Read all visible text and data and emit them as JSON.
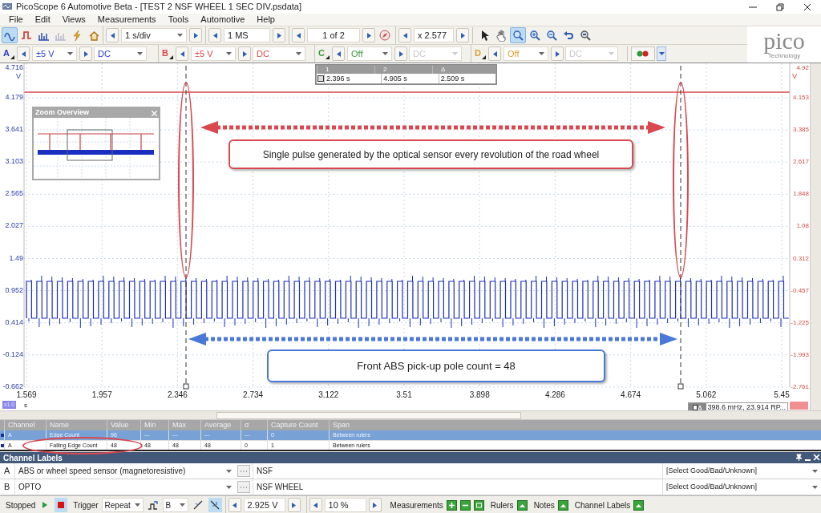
{
  "window": {
    "title": "PicoScope 6 Automotive Beta - [TEST 2  NSF WHEEL 1 SEC DIV.psdata]"
  },
  "menu": [
    "File",
    "Edit",
    "Views",
    "Measurements",
    "Tools",
    "Automotive",
    "Help"
  ],
  "toolbar": {
    "modes": [
      {
        "kind": "scope",
        "selected": true
      },
      {
        "kind": "persistence",
        "selected": false
      },
      {
        "kind": "spectrum",
        "selected": false
      },
      {
        "kind": "spectrum-disabled",
        "selected": false
      },
      {
        "kind": "lightning",
        "selected": false
      },
      {
        "kind": "home",
        "selected": false
      }
    ],
    "timebase": "1 s/div",
    "samples": "1 MS",
    "buffer": "1 of 2",
    "zoom": "x 2.577",
    "tools": [
      {
        "kind": "pointer",
        "selected": false
      },
      {
        "kind": "hand",
        "selected": false
      },
      {
        "kind": "zoom-select",
        "selected": true
      },
      {
        "kind": "zoom-in",
        "selected": false
      },
      {
        "kind": "zoom-out",
        "selected": false
      },
      {
        "kind": "undo",
        "selected": false
      },
      {
        "kind": "zoom-fit",
        "selected": false
      }
    ]
  },
  "channels": [
    {
      "letter": "A",
      "color": "#2b3fc4",
      "range": "±5 V",
      "coupling": "DC",
      "enabled": true
    },
    {
      "letter": "B",
      "color": "#e04848",
      "range": "±5 V",
      "coupling": "DC",
      "enabled": true
    },
    {
      "letter": "C",
      "color": "#3a9a3a",
      "range": "Off",
      "coupling": "DC",
      "enabled": false
    },
    {
      "letter": "D",
      "color": "#d9a030",
      "range": "Off",
      "coupling": "DC",
      "enabled": false
    }
  ],
  "logo": {
    "name": "pico",
    "tagline": "Technology"
  },
  "scope": {
    "left_axis": {
      "unit": "V",
      "ticks": [
        "4.716",
        "4.179",
        "3.641",
        "3.103",
        "2.565",
        "2.027",
        "1.49",
        "0.952",
        "0.414",
        "-0.124",
        "-0.662"
      ]
    },
    "right_axis": {
      "unit": "V",
      "ticks": [
        "4.92",
        "4.153",
        "3.385",
        "2.617",
        "1.848",
        "1.08",
        "0.312",
        "-0.457",
        "-1.225",
        "-1.993",
        "-2.761"
      ]
    },
    "x_axis": {
      "unit": "s",
      "zoom_badge": "x1.0",
      "ticks": [
        "1.569",
        "1.957",
        "2.346",
        "2.734",
        "3.122",
        "3.51",
        "3.898",
        "4.286",
        "4.674",
        "5.062",
        "5.45"
      ]
    },
    "rulers_panel": {
      "columns": [
        "1",
        "2",
        "Δ"
      ],
      "values": [
        "2.396 s",
        "4.905 s",
        "2.509 s"
      ]
    },
    "zoom_overview": {
      "title": "Zoom Overview"
    },
    "annotations": [
      {
        "text": "Single pulse generated by the optical sensor every revolution of the road wheel",
        "color": "#d9474f"
      },
      {
        "text": "Front ABS pick-up pole count = 48",
        "color": "#4a78d8"
      }
    ],
    "readout": "398.6 mHz, 23.914 RP..."
  },
  "measurements": {
    "columns": [
      "Channel",
      "Name",
      "Value",
      "Min",
      "Max",
      "Average",
      "σ",
      "Capture Count",
      "Span"
    ],
    "rows": [
      {
        "selected": true,
        "cells": [
          "A",
          "Edge Count",
          "96",
          "---",
          "---",
          "---",
          "---",
          "0",
          "Between rulers"
        ]
      },
      {
        "selected": false,
        "cells": [
          "A",
          "Falling Edge Count",
          "48",
          "48",
          "48",
          "48",
          "0",
          "1",
          "Between rulers"
        ]
      }
    ]
  },
  "channel_labels": {
    "title": "Channel Labels",
    "rows": [
      {
        "channel": "A",
        "sensor": "ABS or wheel speed sensor (magnetoresistive)",
        "label": "NSF",
        "status": "[Select Good/Bad/Unknown]"
      },
      {
        "channel": "B",
        "sensor": "OPTO",
        "label": "NSF WHEEL",
        "status": "[Select Good/Bad/Unknown]"
      }
    ]
  },
  "status_bar": {
    "state": "Stopped",
    "run_buttons": [
      {
        "kind": "play",
        "selected": false
      },
      {
        "kind": "stop",
        "selected": true
      }
    ],
    "trigger_label": "Trigger",
    "trigger_mode": "Repeat",
    "trigger_source": "B",
    "edges": [
      {
        "kind": "rising",
        "selected": false
      },
      {
        "kind": "falling",
        "selected": true
      }
    ],
    "threshold": "2.925 V",
    "pretrigger": "10 %",
    "panels": [
      {
        "label": "Measurements",
        "kind": "measurements"
      },
      {
        "label": "Rulers",
        "kind": "single"
      },
      {
        "label": "Notes",
        "kind": "single"
      },
      {
        "label": "Channel Labels",
        "kind": "single"
      }
    ]
  }
}
